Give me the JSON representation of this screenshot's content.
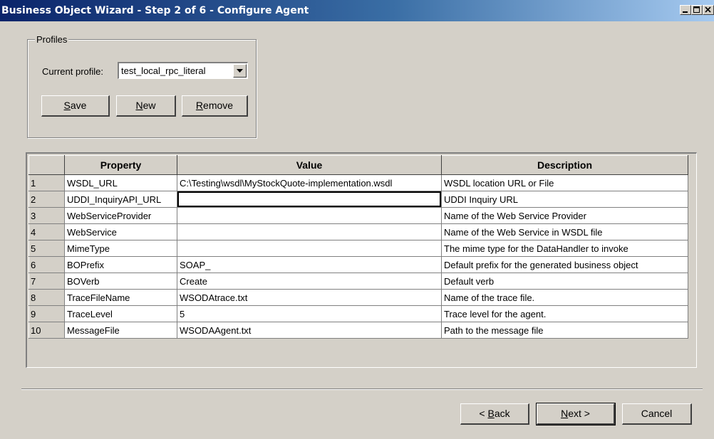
{
  "window": {
    "title": "Business Object Wizard - Step 2 of 6 - Configure Agent"
  },
  "profiles": {
    "legend": "Profiles",
    "current_profile_label": "Current profile:",
    "selected_profile": "test_local_rpc_literal",
    "save_mnemonic": "S",
    "save_rest": "ave",
    "new_mnemonic": "N",
    "new_rest": "ew",
    "remove_mnemonic": "R",
    "remove_rest": "emove"
  },
  "grid": {
    "headers": [
      "",
      "Property",
      "Value",
      "Description"
    ],
    "rows": [
      {
        "num": "1",
        "property": "WSDL_URL",
        "value": "C:\\Testing\\wsdl\\MyStockQuote-implementation.wsdl",
        "description": "WSDL location URL or File"
      },
      {
        "num": "2",
        "property": "UDDI_InquiryAPI_URL",
        "value": "",
        "description": "UDDI Inquiry URL"
      },
      {
        "num": "3",
        "property": "WebServiceProvider",
        "value": "",
        "description": "Name of the Web Service Provider"
      },
      {
        "num": "4",
        "property": "WebService",
        "value": "",
        "description": "Name of the Web Service in WSDL file"
      },
      {
        "num": "5",
        "property": "MimeType",
        "value": "",
        "description": "The mime type for the DataHandler to invoke"
      },
      {
        "num": "6",
        "property": "BOPrefix",
        "value": "SOAP_",
        "description": "Default prefix for the generated business object"
      },
      {
        "num": "7",
        "property": "BOVerb",
        "value": "Create",
        "description": "Default verb"
      },
      {
        "num": "8",
        "property": "TraceFileName",
        "value": "WSODAtrace.txt",
        "description": "Name of the trace file."
      },
      {
        "num": "9",
        "property": "TraceLevel",
        "value": "5",
        "description": "Trace level for the agent."
      },
      {
        "num": "10",
        "property": "MessageFile",
        "value": "WSODAAgent.txt",
        "description": "Path to the message file"
      }
    ]
  },
  "footer": {
    "back_prefix": "< ",
    "back_mnemonic": "B",
    "back_rest": "ack",
    "next_mnemonic": "N",
    "next_rest": "ext >",
    "cancel_label": "Cancel"
  },
  "colors": {
    "titlebar_start": "#0a246a",
    "titlebar_end": "#a6caf0",
    "face": "#d4d0c8"
  },
  "icons": [
    "minimize-icon",
    "maximize-icon",
    "close-icon",
    "dropdown-arrow-icon"
  ]
}
